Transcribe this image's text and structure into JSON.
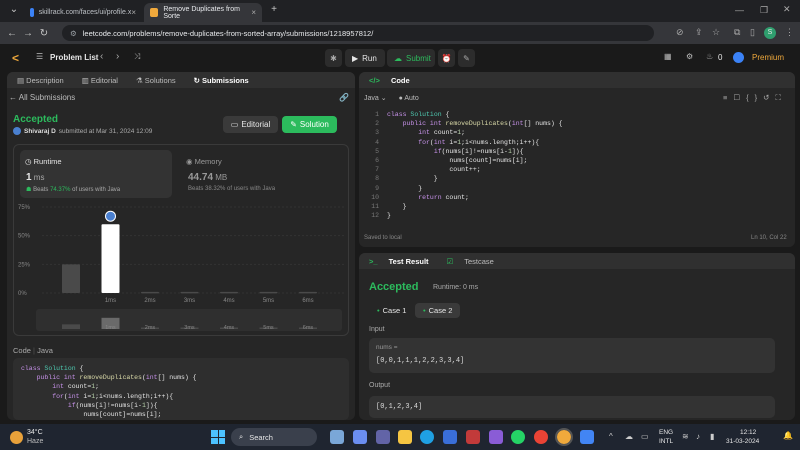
{
  "browser": {
    "tabs": [
      {
        "title": "skillrack.com/faces/ui/profile.x"
      },
      {
        "title": "Remove Duplicates from Sorte"
      }
    ],
    "url": "leetcode.com/problems/remove-duplicates-from-sorted-array/submissions/1218957812/"
  },
  "header": {
    "problem_list": "Problem List",
    "run": "Run",
    "submit": "Submit",
    "streak": "0",
    "premium": "Premium",
    "avatar": "S"
  },
  "left": {
    "tabs": [
      "Description",
      "Editorial",
      "Solutions",
      "Submissions"
    ],
    "back": "All Submissions",
    "status": "Accepted",
    "user": "Shivaraj D",
    "submitted": "submitted at Mar 31, 2024 12:09",
    "editorial_btn": "Editorial",
    "solution_btn": "Solution",
    "runtime": {
      "label": "Runtime",
      "value": "1",
      "unit": "ms",
      "beats_pre": "Beats",
      "beats_pct": "74.37%",
      "beats_post": "of users with Java"
    },
    "memory": {
      "label": "Memory",
      "value": "44.74",
      "unit": "MB",
      "beats_pre": "Beats",
      "beats_pct": "38.32%",
      "beats_post": "of users with Java"
    },
    "code_tab": "Code",
    "code_lang": "Java"
  },
  "chart_data": {
    "type": "bar",
    "categories": [
      "0ms",
      "1ms",
      "2ms",
      "3ms",
      "4ms",
      "5ms",
      "6ms"
    ],
    "tick_labels": [
      "1ms",
      "2ms",
      "3ms",
      "4ms",
      "5ms",
      "6ms"
    ],
    "values": [
      25,
      60,
      1,
      1,
      1,
      1,
      1
    ],
    "y_ticks": [
      "75%",
      "50%",
      "25%",
      "0%"
    ],
    "ylim": [
      0,
      75
    ],
    "highlight": "1ms",
    "colors": {
      "bar": "#4a4a4a",
      "highlight": "#ffffff"
    }
  },
  "editor": {
    "title": "Code",
    "lang": "Java",
    "auto": "Auto",
    "saved": "Saved to local",
    "pos": "Ln 10, Col 22",
    "lines": [
      "1",
      "2",
      "3",
      "4",
      "5",
      "6",
      "7",
      "8",
      "9",
      "10",
      "11",
      "12"
    ]
  },
  "test": {
    "tab1": "Test Result",
    "tab2": "Testcase",
    "status": "Accepted",
    "runtime": "Runtime: 0 ms",
    "case1": "Case 1",
    "case2": "Case 2",
    "input_label": "Input",
    "param": "nums =",
    "input": "[0,0,1,1,1,2,2,3,3,4]",
    "output_label": "Output",
    "output": "[0,1,2,3,4]"
  },
  "taskbar": {
    "temp": "34°C",
    "weather": "Haze",
    "search": "Search",
    "lang1": "ENG",
    "lang2": "INTL",
    "time": "12:12",
    "date": "31-03-2024"
  }
}
